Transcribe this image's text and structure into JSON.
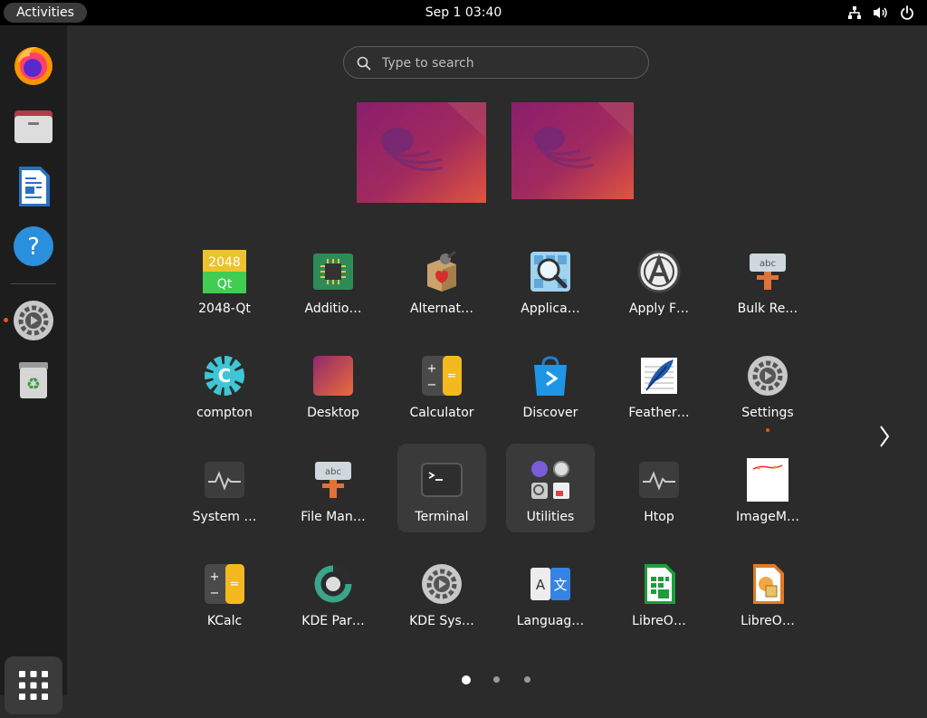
{
  "topbar": {
    "activities": "Activities",
    "clock": "Sep 1  03:40",
    "tray_icons": [
      "network-icon",
      "volume-icon",
      "power-icon"
    ]
  },
  "dock": {
    "items": [
      {
        "name": "firefox",
        "icon": "firefox-icon"
      },
      {
        "name": "files",
        "icon": "files-icon"
      },
      {
        "name": "libreoffice-writer",
        "icon": "writer-icon"
      },
      {
        "name": "help",
        "icon": "help-icon"
      },
      {
        "name": "settings",
        "icon": "settings-icon",
        "running": true
      },
      {
        "name": "trash",
        "icon": "trash-icon"
      }
    ],
    "show_apps_icon": "grid-icon"
  },
  "search": {
    "placeholder": "Type to search"
  },
  "apps": [
    {
      "label": "2048-Qt",
      "icon": "2048-icon"
    },
    {
      "label": "Additio…",
      "icon": "chip-icon"
    },
    {
      "label": "Alternat…",
      "icon": "box-icon"
    },
    {
      "label": "Applica…",
      "icon": "app-finder-icon"
    },
    {
      "label": "Apply F…",
      "icon": "apply-icon"
    },
    {
      "label": "Bulk Re…",
      "icon": "bulk-rename-icon"
    },
    {
      "label": "compton",
      "icon": "compton-icon"
    },
    {
      "label": "Desktop",
      "icon": "desktop-icon"
    },
    {
      "label": "Calculator",
      "icon": "calculator-icon"
    },
    {
      "label": "Discover",
      "icon": "discover-icon"
    },
    {
      "label": "Feather…",
      "icon": "feather-icon"
    },
    {
      "label": "Settings",
      "icon": "settings-icon",
      "running": true
    },
    {
      "label": "System …",
      "icon": "system-monitor-icon"
    },
    {
      "label": "File Man…",
      "icon": "file-manager-icon"
    },
    {
      "label": "Terminal",
      "icon": "terminal-icon",
      "highlighted": true
    },
    {
      "label": "Utilities",
      "icon": "utilities-folder-icon",
      "highlighted": true
    },
    {
      "label": "Htop",
      "icon": "htop-icon"
    },
    {
      "label": "ImageM…",
      "icon": "imagemagick-icon"
    },
    {
      "label": "KCalc",
      "icon": "kcalc-icon"
    },
    {
      "label": "KDE Par…",
      "icon": "kde-partition-icon"
    },
    {
      "label": "KDE Sys…",
      "icon": "kde-system-settings-icon"
    },
    {
      "label": "Languag…",
      "icon": "language-icon"
    },
    {
      "label": "LibreO…",
      "icon": "calc-icon"
    },
    {
      "label": "LibreO…",
      "icon": "draw-icon"
    }
  ],
  "pagination": {
    "pages": 3,
    "current": 1
  },
  "colors": {
    "accent": "#e95420",
    "topbar": "#000000",
    "dock": "#1d1d1d",
    "background": "#2b2b2b"
  }
}
